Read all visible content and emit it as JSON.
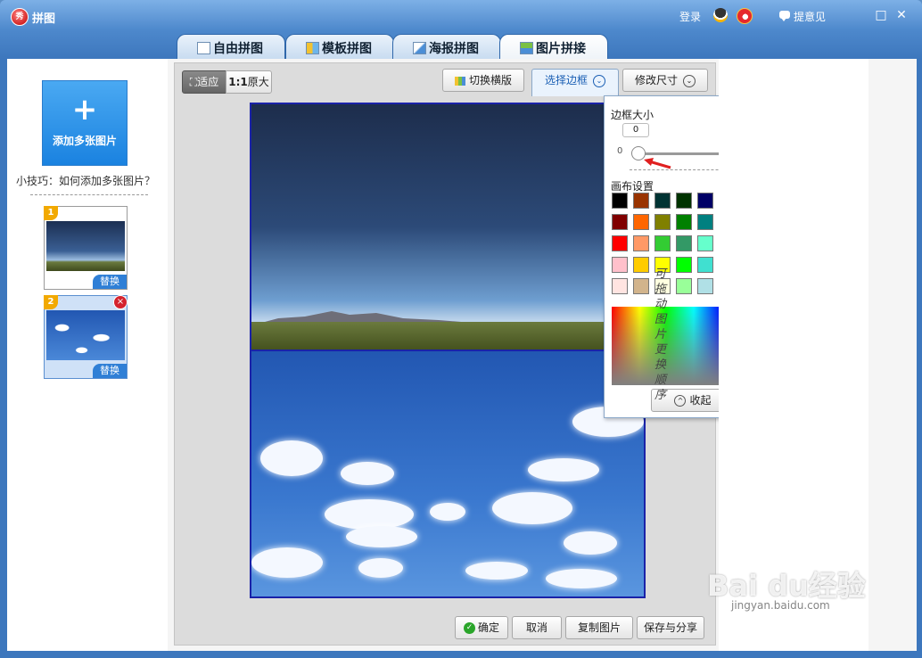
{
  "window": {
    "logo_text": "秀",
    "title": "拼图",
    "login": "登录",
    "feedback": "提意见",
    "maximize": "□",
    "close": "✕"
  },
  "tabs": [
    {
      "label": "自由拼图",
      "active": false
    },
    {
      "label": "模板拼图",
      "active": false
    },
    {
      "label": "海报拼图",
      "active": false
    },
    {
      "label": "图片拼接",
      "active": true
    }
  ],
  "sidebar": {
    "add_plus": "+",
    "add_label": "添加多张图片",
    "tip": "小技巧：如何添加多张图片？",
    "thumbs": [
      {
        "index": "1",
        "replace": "替换"
      },
      {
        "index": "2",
        "replace": "替换",
        "delete": "×"
      }
    ]
  },
  "toolbar": {
    "fit": "适应",
    "ratio_bold": "1:1",
    "ratio": "原大",
    "switch_layout": "切换横版",
    "select_border": "选择边框",
    "resize": "修改尺寸"
  },
  "border_popup": {
    "size_title": "边框大小",
    "value": "0",
    "min": "0",
    "max": "100",
    "slider_fraction": 0,
    "canvas_title": "画布设置",
    "collapse": "收起",
    "swatches": [
      [
        "#000000",
        "#993300",
        "#003333",
        "#003300",
        "#000066",
        "#000099",
        "#4b0082",
        "#333333"
      ],
      [
        "#800000",
        "#ff6600",
        "#808000",
        "#008000",
        "#008080",
        "#0000ff",
        "#6666cc",
        "#555555"
      ],
      [
        "#ff0000",
        "#ff9966",
        "#33cc33",
        "#339966",
        "#66ffcc",
        "#6699cc",
        "#800080",
        "#808080"
      ],
      [
        "#ffc0cb",
        "#ffcc00",
        "#ffff00",
        "#00ff00",
        "#40e0d0",
        "#c0ffff",
        "#4d0033",
        "#c0c0c0"
      ],
      [
        "#ffe4e1",
        "#d2b48c",
        "#ffffe0",
        "#99ff99",
        "#b0e0e6",
        "#708090",
        "#e6e6fa",
        "#ffffff"
      ]
    ],
    "selected_swatch": "#ffffff"
  },
  "hint_handwritten": "可拖动图片更换顺序",
  "actions": {
    "ok": "确定",
    "cancel": "取消",
    "copy": "复制图片",
    "save_share": "保存与分享"
  },
  "watermark": {
    "brand": "Bai du经验",
    "url": "jingyan.baidu.com"
  }
}
